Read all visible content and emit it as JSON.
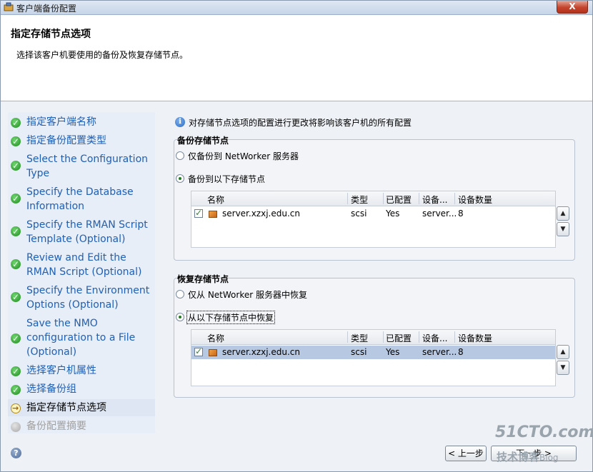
{
  "window": {
    "title": "客户端备份配置",
    "close_label": "X"
  },
  "header": {
    "title": "指定存储节点选项",
    "subtitle": "选择该客户机要使用的备份及恢复存储节点。"
  },
  "nav": {
    "items": [
      {
        "label": "指定客户端名称",
        "state": "done"
      },
      {
        "label": "指定备份配置类型",
        "state": "done"
      },
      {
        "label": "Select the Configuration Type",
        "state": "done"
      },
      {
        "label": "Specify the Database Information",
        "state": "done"
      },
      {
        "label": "Specify the RMAN Script Template (Optional)",
        "state": "done"
      },
      {
        "label": "Review and Edit the RMAN Script (Optional)",
        "state": "done"
      },
      {
        "label": "Specify the Environment Options (Optional)",
        "state": "done"
      },
      {
        "label": "Save the NMO configuration to a File (Optional)",
        "state": "done"
      },
      {
        "label": "选择客户机属性",
        "state": "done"
      },
      {
        "label": "选择备份组",
        "state": "done"
      },
      {
        "label": "指定存储节点选项",
        "state": "current"
      },
      {
        "label": "备份配置摘要",
        "state": "disabled"
      }
    ]
  },
  "info": {
    "text": "对存储节点选项的配置进行更改将影响该客户机的所有配置"
  },
  "backup_group": {
    "title": "备份存储节点",
    "option_server_only": "仅备份到 NetWorker 服务器",
    "option_following": "备份到以下存储节点",
    "selected": "option_following",
    "columns": [
      "名称",
      "类型",
      "已配置",
      "设备...",
      "设备数量"
    ],
    "rows": [
      {
        "checked": true,
        "name": "server.xzxj.edu.cn",
        "type": "scsi",
        "configured": "Yes",
        "device": "server...",
        "device_count": "8"
      }
    ]
  },
  "recover_group": {
    "title": "恢复存储节点",
    "option_server_only": "仅从 NetWorker 服务器中恢复",
    "option_following": "从以下存储节点中恢复",
    "selected": "option_following",
    "columns": [
      "名称",
      "类型",
      "已配置",
      "设备...",
      "设备数量"
    ],
    "rows": [
      {
        "checked": true,
        "name": "server.xzxj.edu.cn",
        "type": "scsi",
        "configured": "Yes",
        "device": "server...",
        "device_count": "8"
      }
    ]
  },
  "footer": {
    "help_label": "?",
    "prev_label": "< 上一步",
    "next_label": "下一步 >"
  },
  "watermark": {
    "site": "51CTO.com",
    "blog": "技术博客",
    "blog_suffix": "Blog"
  }
}
